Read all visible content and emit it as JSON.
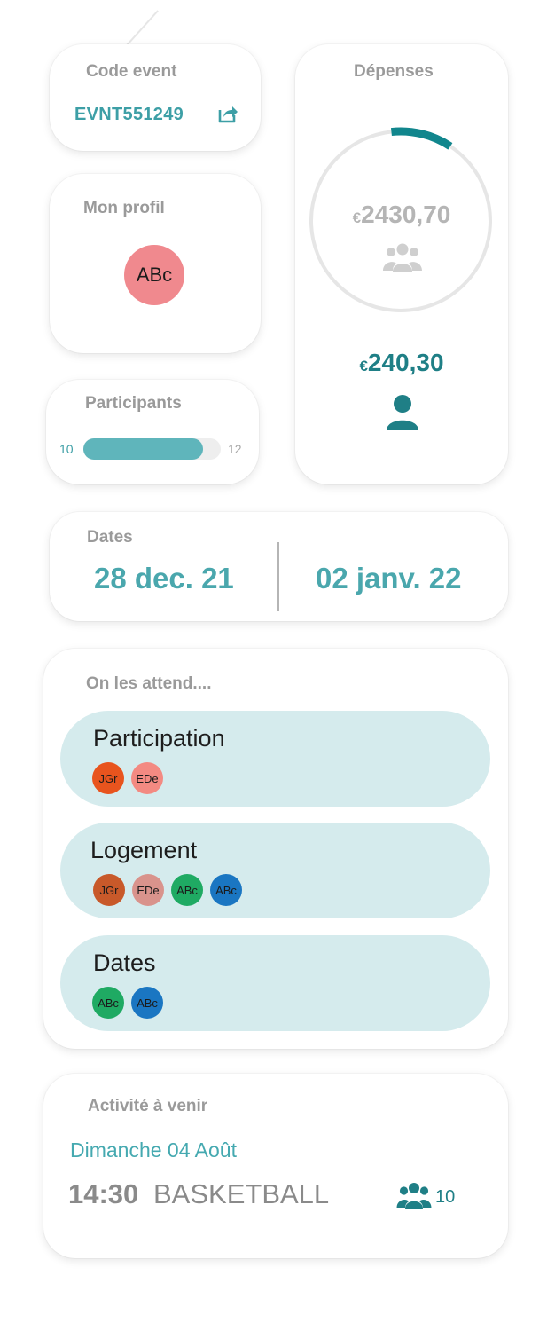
{
  "code_event": {
    "title": "Code event",
    "code": "EVNT551249",
    "share_icon": "share-icon"
  },
  "profil": {
    "title": "Mon profil",
    "initials": "ABc",
    "avatar_color": "#f0898e"
  },
  "participants": {
    "title": "Participants",
    "current": "10",
    "max": "12",
    "fill_fraction": 0.87,
    "fill_color": "#5fb5bb"
  },
  "depenses": {
    "title": "Dépenses",
    "total_currency": "€",
    "total_value": "2430,70",
    "mine_currency": "€",
    "mine_value": "240,30",
    "ring_fraction": 0.11,
    "ring_color": "#11868d",
    "group_icon": "group-icon",
    "person_icon": "person-icon"
  },
  "dates": {
    "title": "Dates",
    "start": "28 dec. 21",
    "end": "02 janv. 22"
  },
  "attend": {
    "title": "On les attend....",
    "items": [
      {
        "label": "Participation",
        "avatars": [
          {
            "initials": "JGr",
            "color": "#e8541e"
          },
          {
            "initials": "EDe",
            "color": "#f38a82"
          }
        ]
      },
      {
        "label": "Logement",
        "avatars": [
          {
            "initials": "JGr",
            "color": "#c8592a"
          },
          {
            "initials": "EDe",
            "color": "#d9938c"
          },
          {
            "initials": "ABc",
            "color": "#1faa63"
          },
          {
            "initials": "ABc",
            "color": "#1a76c2"
          }
        ]
      },
      {
        "label": "Dates",
        "avatars": [
          {
            "initials": "ABc",
            "color": "#1faa63"
          },
          {
            "initials": "ABc",
            "color": "#1a76c2"
          }
        ]
      }
    ]
  },
  "activite": {
    "title": "Activité à venir",
    "date": "Dimanche 04 Août",
    "time": "14:30",
    "name": "BASKETBALL",
    "count": "10",
    "group_icon": "group-icon"
  }
}
